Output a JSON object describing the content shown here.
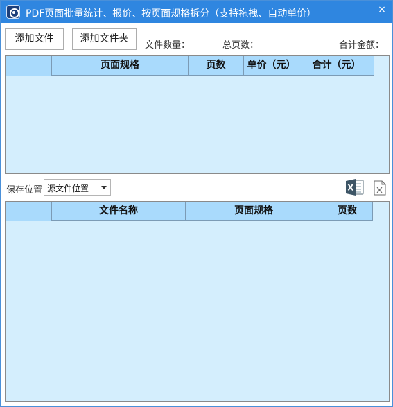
{
  "window": {
    "title": "PDF页面批量统计、报价、按页面规格拆分（支持拖拽、自动单价）",
    "close_glyph": "×"
  },
  "toolbar": {
    "add_file_label": "添加文件",
    "add_folder_label": "添加文件夹"
  },
  "stats": {
    "file_count_label": "文件数量：",
    "total_pages_label": "总页数：",
    "total_amount_label": "合计金额："
  },
  "top_table": {
    "columns": [
      "",
      "页面规格",
      "页数",
      "单价（元）",
      "合计（元）"
    ],
    "rows": []
  },
  "save": {
    "label": "保存位置",
    "selected": "源文件位置"
  },
  "icons": {
    "app": "pdf-app-icon",
    "close": "close-icon",
    "excel": "excel-icon",
    "xls_file": "xls-file-icon",
    "dropdown": "chevron-down-icon"
  },
  "colors": {
    "titlebar": "#2f86e0",
    "grid_bg": "#d4eefd",
    "grid_header": "#a9dafc",
    "excel_green": "#1e6f44"
  },
  "bottom_table": {
    "columns": [
      "",
      "文件名称",
      "页面规格",
      "页数"
    ],
    "rows": []
  }
}
